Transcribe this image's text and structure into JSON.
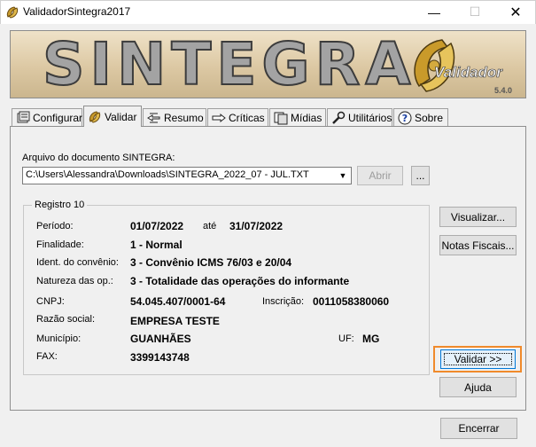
{
  "window": {
    "title": "ValidadorSintegra2017",
    "minimize": "—",
    "maximize": "☐",
    "close": "✕"
  },
  "banner": {
    "title": "SINTEGRA",
    "subtitle": "Validador",
    "version": "5.4.0"
  },
  "tabs": [
    {
      "label": "Configurar"
    },
    {
      "label": "Validar"
    },
    {
      "label": "Resumo"
    },
    {
      "label": "Críticas"
    },
    {
      "label": "Mídias"
    },
    {
      "label": "Utilitários"
    },
    {
      "label": "Sobre"
    }
  ],
  "file": {
    "label": "Arquivo do documento SINTEGRA:",
    "value": "C:\\Users\\Alessandra\\Downloads\\SINTEGRA_2022_07 - JUL.TXT",
    "open_label": "Abrir",
    "browse_label": "..."
  },
  "registro": {
    "title": "Registro 10",
    "periodo_label": "Período:",
    "periodo_inicio": "01/07/2022",
    "periodo_ate": "até",
    "periodo_fim": "31/07/2022",
    "finalidade_label": "Finalidade:",
    "finalidade": "1 - Normal",
    "convenio_label": "Ident. do convênio:",
    "convenio": "3 - Convênio ICMS 76/03 e 20/04",
    "natureza_label": "Natureza das op.:",
    "natureza": "3 - Totalidade das operações do informante",
    "cnpj_label": "CNPJ:",
    "cnpj": "54.045.407/0001-64",
    "inscricao_label": "Inscrição:",
    "inscricao": "0011058380060",
    "razao_label": "Razão social:",
    "razao": "EMPRESA TESTE",
    "municipio_label": "Município:",
    "municipio": "GUANHÃES",
    "uf_label": "UF:",
    "uf": "MG",
    "fax_label": "FAX:",
    "fax": "3399143748"
  },
  "buttons": {
    "visualizar": "Visualizar...",
    "notas": "Notas Fiscais...",
    "validar": "Validar >>",
    "ajuda": "Ajuda",
    "encerrar": "Encerrar"
  },
  "colors": {
    "highlight": "#f08a2b",
    "default_button_border": "#0078d7"
  }
}
